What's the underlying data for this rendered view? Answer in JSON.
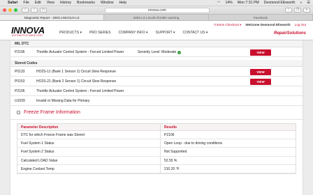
{
  "menubar": {
    "app": "Safari",
    "items": [
      "File",
      "Edit",
      "View",
      "History",
      "Bookmarks",
      "Window",
      "Help"
    ],
    "battery": "14%",
    "clock": "Mon 7:31 PM",
    "user": "Desmond Ellsworth"
  },
  "browser": {
    "url": "innova.com",
    "tabs": [
      "Diagnostic Report - 2003 LINCOLN LS",
      "2003 LS Lincoln throttle warning",
      "Facebook"
    ]
  },
  "header": {
    "logo": "INNOVA",
    "tagline": "AUTOMOTIVE MADE EASY",
    "nav": [
      "PRODUCTS ▾",
      "PRO SERIES",
      "COMPANY INFO ▾",
      "SUPPORT ▾",
      "CONTACT US ▾"
    ],
    "cart": "0 items Checkout ▾",
    "welcome": "Welcome Desmond Ellsworth",
    "logout": "Log Out",
    "brand": "RepairSolutions"
  },
  "mil": {
    "heading": "MIL DTC",
    "rows": [
      {
        "code": "P2106",
        "desc": "Throttle Actuator Control System - Forced Limited Power",
        "severity": "Severity Level: Moderate",
        "view": "VIEW"
      }
    ]
  },
  "stored": {
    "heading": "Stored Codes",
    "rows": [
      {
        "code": "P0133",
        "desc": "HO2S-11 (Bank 1 Sensor 1) Circuit Slow Response",
        "view": "VIEW"
      },
      {
        "code": "P0153",
        "desc": "HO2S-21 (Bank 2 Sensor 1) Circuit Slow Response",
        "view": "VIEW"
      },
      {
        "code": "P2106",
        "desc": "Throttle Actuator Control System - Forced Limited Power",
        "view": ""
      },
      {
        "code": "U1039",
        "desc": "Invalid or Missing Data for Primary",
        "view": ""
      }
    ]
  },
  "freeze_frame": {
    "title": "Freeze Frame Information",
    "toggle": "−",
    "col_param": "Parameter Description",
    "col_result": "Results",
    "rows": [
      {
        "param": "DTC for which Freeze Frame was Stored",
        "result": "P2106"
      },
      {
        "param": "Fuel System 1 Status",
        "result": "Open Loop - due to driving conditions"
      },
      {
        "param": "Fuel System 2 Status",
        "result": "Not Supported"
      },
      {
        "param": "Calculated LOAD Value",
        "result": "52.55 %"
      },
      {
        "param": "Engine Coolant Temp",
        "result": "210.20 °F"
      }
    ]
  }
}
